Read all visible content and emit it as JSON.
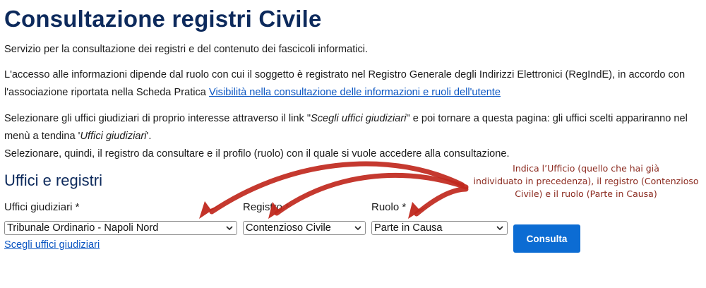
{
  "page": {
    "title": "Consultazione registri Civile",
    "intro": "Servizio per la consultazione dei registri e del contenuto dei fascicoli informatici.",
    "access_text": "L'accesso alle informazioni dipende dal ruolo con cui il soggetto è registrato nel Registro Generale degli Indirizzi Elettronici (RegIndE), in accordo con l'associazione riportata nella Scheda Pratica ",
    "access_link": "Visibilità nella consultazione delle informazioni e ruoli dell'utente",
    "select_text_1": "Selezionare gli uffici giudiziari di proprio interesse attraverso il link \"",
    "select_text_em1": "Scegli uffici giudiziari",
    "select_text_2": "\" e poi tornare a questa pagina: gli uffici scelti appariranno nel menù a tendina '",
    "select_text_em2": "Uffici giudiziari",
    "select_text_3": "'.",
    "select_text_4": "Selezionare, quindi, il registro da consultare e il profilo (ruolo) con il quale si vuole accedere alla consultazione."
  },
  "form": {
    "section_title": "Uffici e registri",
    "uffici_label": "Uffici giudiziari *",
    "uffici_value": "Tribunale Ordinario - Napoli Nord",
    "registro_label": "Registro *",
    "registro_value": "Contenzioso Civile",
    "ruolo_label": "Ruolo *",
    "ruolo_value": "Parte in Causa",
    "scegli_link": "Scegli uffici giudiziari",
    "consulta_button": "Consulta"
  },
  "annotation": {
    "text": "Indica l’Ufficio (quello che hai già\nindividuato in precedenza), il registro (Contenzioso\nCivile) e il ruolo (Parte in Causa)",
    "color": "#c0281d"
  },
  "colors": {
    "title": "#0d2a5c",
    "link": "#0a55c2",
    "button": "#0c6cd3"
  }
}
